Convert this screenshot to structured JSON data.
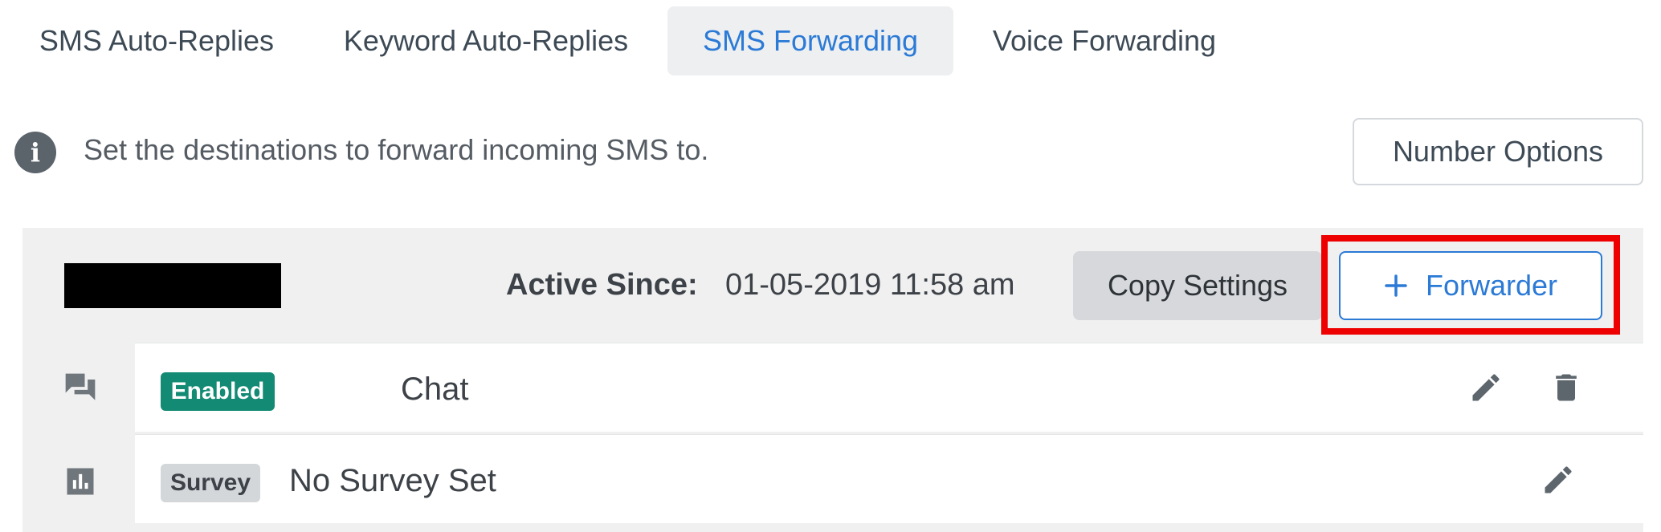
{
  "tabs": [
    {
      "label": "SMS Auto-Replies",
      "active": false
    },
    {
      "label": "Keyword Auto-Replies",
      "active": false
    },
    {
      "label": "SMS Forwarding",
      "active": true
    },
    {
      "label": "Voice Forwarding",
      "active": false
    }
  ],
  "info": {
    "icon": "info-icon",
    "text": "Set the destinations to forward incoming SMS to.",
    "number_options_label": "Number Options"
  },
  "panel": {
    "active_since_label": "Active Since:",
    "active_since_value": "01-05-2019 11:58 am",
    "copy_settings_label": "Copy Settings",
    "forwarder_label": "Forwarder",
    "forwarder_icon": "plus-icon",
    "rows": [
      {
        "icon": "chat-icon",
        "badge": "Enabled",
        "text": "Chat",
        "actions": [
          "edit-icon",
          "delete-icon"
        ]
      },
      {
        "icon": "survey-chart-icon",
        "badge": "Survey",
        "text": "No Survey Set",
        "actions": [
          "edit-icon"
        ]
      }
    ]
  },
  "colors": {
    "accent": "#2b7ad6",
    "enabled_badge": "#138a74",
    "highlight": "#ee0000",
    "panel_bg": "#f0f0f0"
  }
}
